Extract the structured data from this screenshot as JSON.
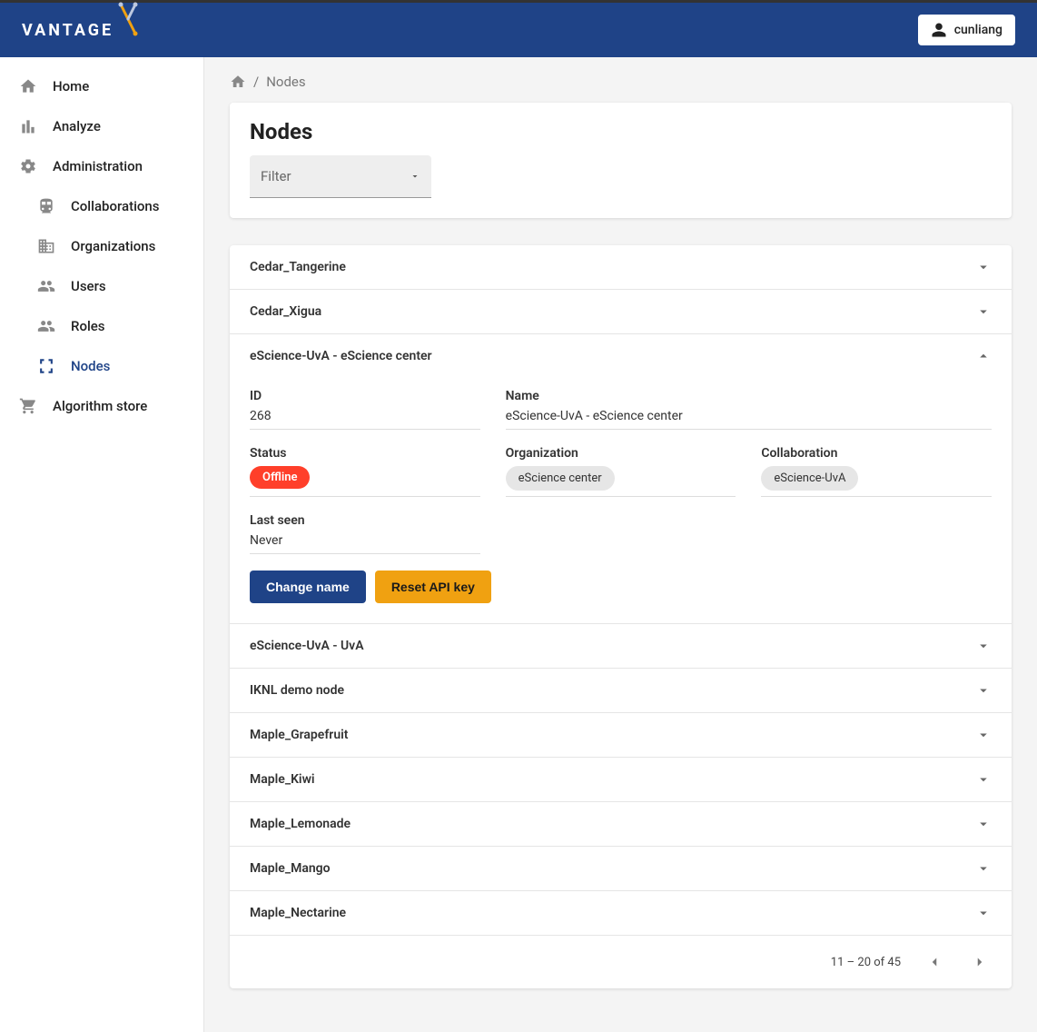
{
  "header": {
    "brand": "VANTAGE",
    "user": "cunliang"
  },
  "sidebar": {
    "items": [
      {
        "label": "Home"
      },
      {
        "label": "Analyze"
      },
      {
        "label": "Administration"
      },
      {
        "label": "Collaborations"
      },
      {
        "label": "Organizations"
      },
      {
        "label": "Users"
      },
      {
        "label": "Roles"
      },
      {
        "label": "Nodes"
      },
      {
        "label": "Algorithm store"
      }
    ]
  },
  "breadcrumb": {
    "separator": "/",
    "current": "Nodes"
  },
  "page": {
    "title": "Nodes",
    "filter_label": "Filter"
  },
  "nodes": [
    {
      "name": "Cedar_Tangerine"
    },
    {
      "name": "Cedar_Xigua"
    },
    {
      "name": "eScience-UvA - eScience center"
    },
    {
      "name": "eScience-UvA - UvA"
    },
    {
      "name": "IKNL demo node"
    },
    {
      "name": "Maple_Grapefruit"
    },
    {
      "name": "Maple_Kiwi"
    },
    {
      "name": "Maple_Lemonade"
    },
    {
      "name": "Maple_Mango"
    },
    {
      "name": "Maple_Nectarine"
    }
  ],
  "detail": {
    "id_label": "ID",
    "id_value": "268",
    "name_label": "Name",
    "name_value": "eScience-UvA - eScience center",
    "status_label": "Status",
    "status_value": "Offline",
    "org_label": "Organization",
    "org_value": "eScience center",
    "collab_label": "Collaboration",
    "collab_value": "eScience-UvA",
    "lastseen_label": "Last seen",
    "lastseen_value": "Never"
  },
  "buttons": {
    "change_name": "Change name",
    "reset_api": "Reset API key"
  },
  "pagination": {
    "range": "11 – 20 of 45"
  }
}
